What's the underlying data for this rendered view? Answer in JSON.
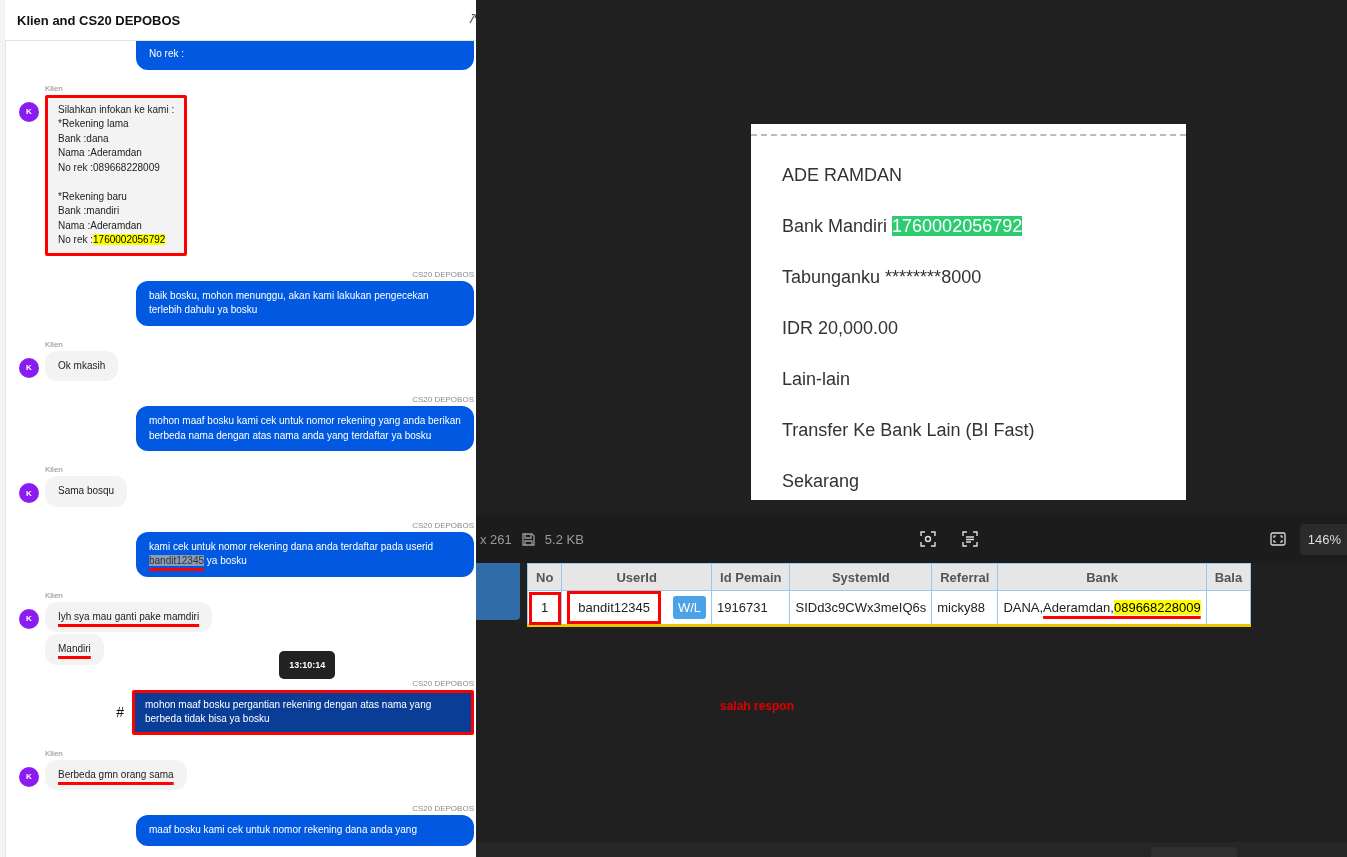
{
  "chat": {
    "title": "Klien and CS20 DEPOBOS",
    "groups": [
      {
        "kind": "agent",
        "bubbles": [
          {
            "segments": [
              {
                "text": "No rek :"
              }
            ],
            "boxed": false,
            "selected": false
          }
        ]
      },
      {
        "kind": "client",
        "name": "Klien",
        "avatar": "K",
        "bubbles": [
          {
            "segments": [
              {
                "text": "Silahkan infokan ke kami :\n*Rekening lama\nBank :dana\nNama :Aderamdan\nNo rek :089668228009\n\n*Rekening baru\nBank :mandiri\nNama :Aderamdan\nNo rek :"
              },
              {
                "text": "1760002056792",
                "kind": "highlight"
              }
            ],
            "boxed": true,
            "selected": false
          }
        ]
      },
      {
        "kind": "agent",
        "name": "CS20 DEPOBOS",
        "bubbles": [
          {
            "segments": [
              {
                "text": "baik bosku, mohon menunggu, akan kami lakukan pengecekan terlebih dahulu ya bosku"
              }
            ],
            "boxed": false,
            "selected": false
          }
        ]
      },
      {
        "kind": "client",
        "name": "Klien",
        "avatar": "K",
        "bubbles": [
          {
            "segments": [
              {
                "text": "Ok mkasih"
              }
            ],
            "boxed": false,
            "selected": false
          }
        ]
      },
      {
        "kind": "agent",
        "name": "CS20 DEPOBOS",
        "bubbles": [
          {
            "segments": [
              {
                "text": "mohon maaf bosku kami cek untuk nomor rekening yang anda berikan berbeda nama dengan atas nama anda yang terdaftar ya bosku"
              }
            ],
            "boxed": false,
            "selected": false
          }
        ]
      },
      {
        "kind": "client",
        "name": "Klien",
        "avatar": "K",
        "bubbles": [
          {
            "segments": [
              {
                "text": "Sama bosqu"
              }
            ],
            "boxed": false,
            "selected": false
          }
        ]
      },
      {
        "kind": "agent",
        "name": "CS20 DEPOBOS",
        "bubbles": [
          {
            "segments": [
              {
                "text": "kami cek untuk nomor rekening dana anda terdaftar pada userid "
              },
              {
                "text": "bandit12345",
                "kind": "selection_underline"
              },
              {
                "text": " ya bosku"
              }
            ],
            "boxed": false,
            "selected": false
          }
        ]
      },
      {
        "kind": "client",
        "name": "Klien",
        "avatar": "K",
        "bubbles": [
          {
            "segments": [
              {
                "text": "Iyh sya mau ganti pake mamdiri",
                "kind": "underline"
              }
            ],
            "boxed": false,
            "selected": false
          },
          {
            "segments": [
              {
                "text": "Mandiri",
                "kind": "underline"
              }
            ],
            "boxed": false,
            "selected": false
          }
        ]
      },
      {
        "kind": "agent",
        "name": "CS20 DEPOBOS",
        "tooltip": "13:10:14",
        "marker": "#",
        "bubbles": [
          {
            "segments": [
              {
                "text": "mohon maaf bosku pergantian rekening dengan atas nama yang berbeda tidak bisa ya bosku"
              }
            ],
            "boxed": true,
            "selected": true
          }
        ]
      },
      {
        "kind": "client",
        "name": "Klien",
        "avatar": "K",
        "bubbles": [
          {
            "segments": [
              {
                "text": "Berbeda gmn orang sama",
                "kind": "underline"
              }
            ],
            "boxed": false,
            "selected": false
          }
        ]
      },
      {
        "kind": "agent",
        "name": "CS20 DEPOBOS",
        "bubbles": [
          {
            "segments": [
              {
                "text": "maaf bosku kami cek untuk nomor rekening dana anda yang"
              }
            ],
            "boxed": false,
            "selected": false
          }
        ]
      }
    ]
  },
  "viewer": {
    "image_lines": [
      [
        {
          "text": "ADE RAMDAN"
        }
      ],
      [
        {
          "text": "Bank Mandiri "
        },
        {
          "text": "1760002056792",
          "kind": "green"
        }
      ],
      [
        {
          "text": "Tabunganku ********8000"
        }
      ],
      [
        {
          "text": "IDR 20,000.00"
        }
      ],
      [
        {
          "text": "Lain-lain"
        }
      ],
      [
        {
          "text": "Transfer Ke Bank Lain (BI Fast)"
        }
      ],
      [
        {
          "text": "Sekarang"
        }
      ]
    ],
    "toolbar": {
      "dimensions": "x 261",
      "size": "5.2 KB",
      "zoom": "146%"
    },
    "table": {
      "columns": [
        "No",
        "UserId",
        "Id Pemain",
        "SystemId",
        "Referral",
        "Bank",
        "Bala"
      ],
      "rows": [
        {
          "cells": [
            {
              "segments": [
                {
                  "text": "1"
                }
              ],
              "boxed": true
            },
            {
              "segments": [
                {
                  "text": "bandit12345"
                }
              ],
              "boxed": true,
              "button": "W/L"
            },
            {
              "segments": [
                {
                  "text": "1916731"
                }
              ],
              "boxed": false
            },
            {
              "segments": [
                {
                  "text": "SIDd3c9CWx3meIQ6s"
                }
              ],
              "boxed": false
            },
            {
              "segments": [
                {
                  "text": "micky88"
                }
              ],
              "boxed": false
            },
            {
              "segments": [
                {
                  "text": "DANA,"
                },
                {
                  "text": "Aderamdan,",
                  "kind": "underline"
                },
                {
                  "text": "089668228009",
                  "kind": "highlight_underline"
                }
              ],
              "boxed": false
            },
            {
              "boxed": false
            }
          ]
        }
      ]
    },
    "note": "salah respon"
  }
}
